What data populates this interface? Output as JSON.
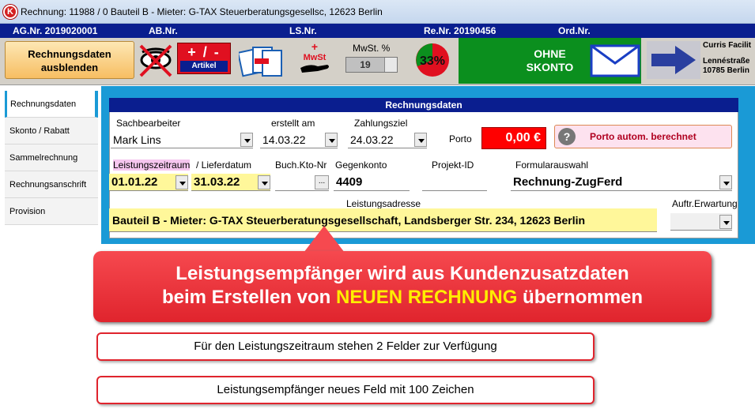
{
  "window": {
    "title": "Rechnung: 11988 / 0 Bauteil B - Mieter: G-TAX Steuerberatungsgesellsc, 12623 Berlin"
  },
  "numbers": {
    "ag": "AG.Nr. 2019020001",
    "ab": "AB.Nr.",
    "ls": "LS.Nr.",
    "re": "Re.Nr. 20190456",
    "ord": "Ord.Nr."
  },
  "toolbar": {
    "hide_label_line1": "Rechnungsdaten",
    "hide_label_line2": "ausblenden",
    "article_big": "+ / -",
    "article_small": "Artikel",
    "mwst_icon_text": "MwSt",
    "mwst_label": "MwSt. %",
    "mwst_value": "19",
    "percent_text": "33%",
    "skonto_line1": "OHNE",
    "skonto_line2": "SKONTO",
    "company_line1": "Curris Facilit",
    "company_line2": "Lennéstraße",
    "company_line3": "10785 Berlin"
  },
  "sidebar": {
    "items": [
      {
        "label": "Rechnungsdaten"
      },
      {
        "label": "Skonto / Rabatt"
      },
      {
        "label": "Sammelrechnung"
      },
      {
        "label": "Rechnungsanschrift"
      },
      {
        "label": "Provision"
      }
    ]
  },
  "form": {
    "header": "Rechnungsdaten",
    "sachbearbeiter_label": "Sachbearbeiter",
    "sachbearbeiter_value": "Mark Lins",
    "erstellt_label": "erstellt am",
    "erstellt_value": "14.03.22",
    "zahlungsziel_label": "Zahlungsziel",
    "zahlungsziel_value": "24.03.22",
    "porto_label": "Porto",
    "porto_value": "0,00 €",
    "porto_button": "Porto autom. berechnet",
    "leistungszeitraum_label": "Leistungszeitraum",
    "lieferdatum_label": "/ Lieferdatum",
    "leistung_from": "01.01.22",
    "leistung_to": "31.03.22",
    "buchkto_label": "Buch.Kto-Nr",
    "ellipsis": "...",
    "gegenkonto_label": "Gegenkonto",
    "gegenkonto_value": "4409",
    "projekt_label": "Projekt-ID",
    "formular_label": "Formularauswahl",
    "formular_value": "Rechnung-ZugFerd",
    "leistungsadresse_label": "Leistungsadresse",
    "leistungsadresse_value": "Bauteil B - Mieter: G-TAX Steuerberatungsgesellschaft, Landsberger Str. 234, 12623 Berlin",
    "auftr_label": "Auftr.Erwartung"
  },
  "annotations": {
    "callout_line1": "Leistungsempfänger wird aus Kundenzusatzdaten",
    "callout_line2_pre": "beim Erstellen von",
    "callout_line2_highlight": "NEUEN RECHNUNG",
    "callout_line2_post": "übernommen",
    "note1": "Für den Leistungszeitraum stehen 2 Felder zur Verfügung",
    "note2": "Leistungsempfänger neues Feld mit 100 Zeichen"
  }
}
